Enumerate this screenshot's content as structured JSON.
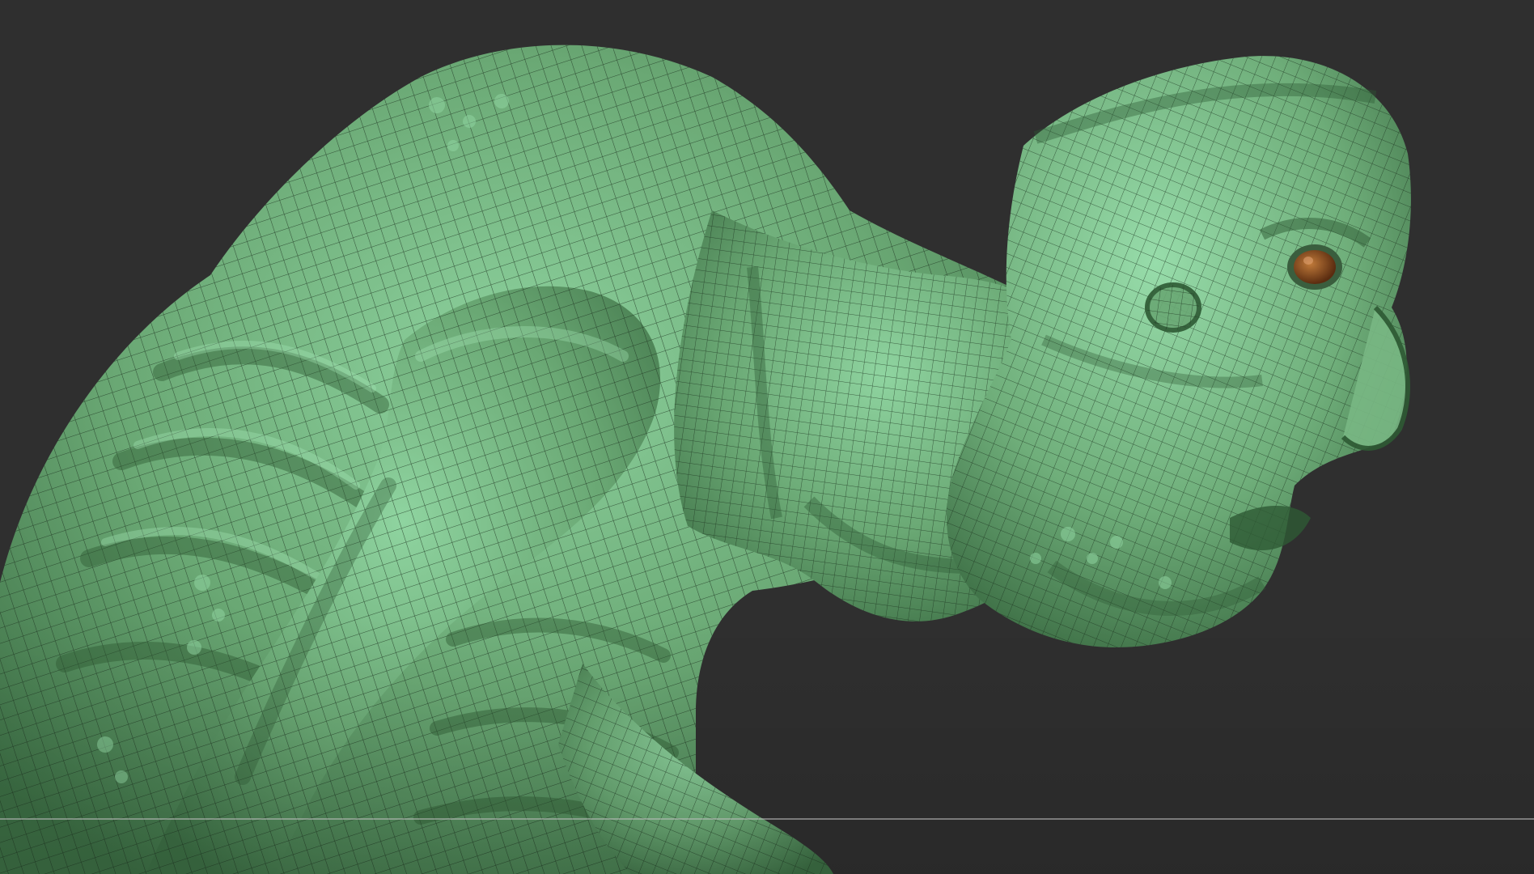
{
  "viewport": {
    "background_color": "#2f2f2f",
    "model": {
      "kind": "sculpted creature mesh",
      "base_color": "#6aa874",
      "highlight_color": "#8fd4a0",
      "shadow_color": "#2e5a34",
      "wireframe_color": "#1d3320",
      "eye_color": "#9a5a2a",
      "wireframe_visible": true
    },
    "floor_line_color": "#bdbdbd"
  }
}
